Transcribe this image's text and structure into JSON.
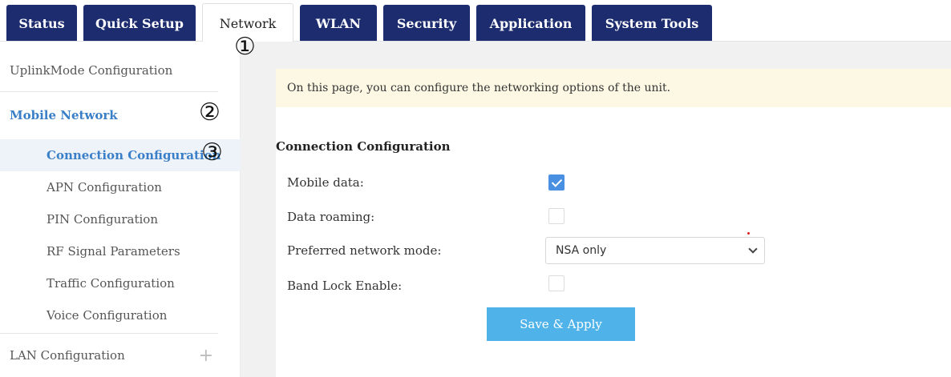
{
  "tabs": [
    {
      "label": "Status"
    },
    {
      "label": "Quick Setup"
    },
    {
      "label": "Network"
    },
    {
      "label": "WLAN"
    },
    {
      "label": "Security"
    },
    {
      "label": "Application"
    },
    {
      "label": "System Tools"
    }
  ],
  "active_tab": "Network",
  "annotations": [
    "①",
    "②",
    "③"
  ],
  "sidebar": {
    "top_item": "UplinkMode Configuration",
    "group_label": "Mobile Network",
    "sub_items": [
      {
        "label": "Connection Configuration",
        "active": true
      },
      {
        "label": "APN Configuration"
      },
      {
        "label": "PIN Configuration"
      },
      {
        "label": "RF Signal Parameters"
      },
      {
        "label": "Traffic Configuration"
      },
      {
        "label": "Voice Configuration"
      }
    ],
    "bottom_item": "LAN Configuration",
    "bottom_item_icon": "plus-icon"
  },
  "main": {
    "notice": "On this page, you can configure the networking options of the unit.",
    "section_title": "Connection Configuration",
    "fields": {
      "mobile_data": {
        "label": "Mobile data:",
        "checked": true
      },
      "data_roaming": {
        "label": "Data roaming:",
        "checked": false
      },
      "preferred_network_mode": {
        "label": "Preferred network mode:",
        "value": "NSA only"
      },
      "band_lock_enable": {
        "label": "Band Lock Enable:",
        "checked": false
      }
    },
    "save_button": "Save & Apply"
  },
  "colors": {
    "tab_bg": "#1d2c6e",
    "accent_blue": "#3a7fc7",
    "checkbox_checked": "#4a90e2",
    "notice_bg": "#fcf8e3",
    "button_bg": "#4fb3ea",
    "content_bg": "#f1f1f1"
  }
}
